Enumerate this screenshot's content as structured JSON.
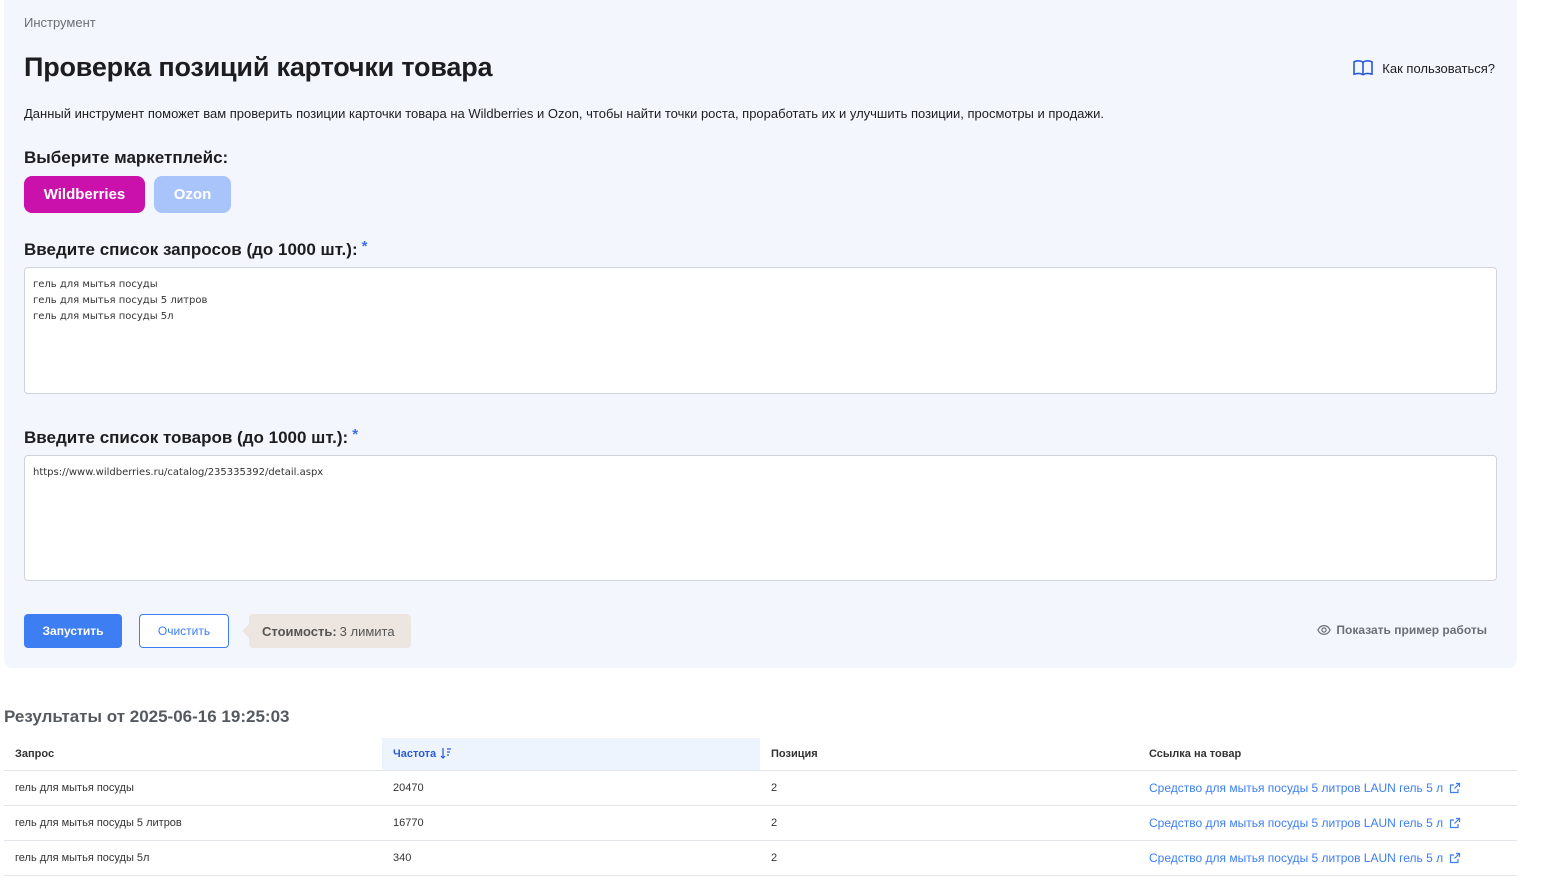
{
  "breadcrumb": "Инструмент",
  "page_title": "Проверка позиций карточки товара",
  "help_link": "Как пользоваться?",
  "description": "Данный инструмент поможет вам проверить позиции карточки товара на Wildberries и Ozon, чтобы найти точки роста, проработать их и улучшить позиции, просмотры и продажи.",
  "marketplace": {
    "label": "Выберите маркетплейс:",
    "options": [
      "Wildberries",
      "Ozon"
    ],
    "selected": "Wildberries"
  },
  "queries": {
    "label": "Введите список запросов (до 1000 шт.):",
    "required_mark": "*",
    "value": "гель для мытья посуды\nгель для мытья посуды 5 литров\nгель для мытья посуды 5л"
  },
  "products": {
    "label": "Введите список товаров (до 1000 шт.):",
    "required_mark": "*",
    "value": "https://www.wildberries.ru/catalog/235335392/detail.aspx"
  },
  "actions": {
    "run": "Запустить",
    "clear": "Очистить",
    "cost_label": "Стоимость:",
    "cost_value": "3 лимита",
    "example": "Показать пример работы"
  },
  "results": {
    "title": "Результаты от 2025-06-16 19:25:03",
    "columns": [
      "Запрос",
      "Частота",
      "Позиция",
      "Ссылка на товар"
    ],
    "rows": [
      {
        "query": "гель для мытья посуды",
        "frequency": "20470",
        "position": "2",
        "link": "Средство для мытья посуды 5 литров LAUN гель 5 л"
      },
      {
        "query": "гель для мытья посуды 5 литров",
        "frequency": "16770",
        "position": "2",
        "link": "Средство для мытья посуды 5 литров LAUN гель 5 л"
      },
      {
        "query": "гель для мытья посуды 5л",
        "frequency": "340",
        "position": "2",
        "link": "Средство для мытья посуды 5 литров LAUN гель 5 л"
      }
    ]
  },
  "icons": {
    "help": "book-icon",
    "example": "eye-icon",
    "sort": "sort-desc-icon",
    "external": "external-link-icon"
  },
  "colors": {
    "wildberries": "#cb11ab",
    "ozon": "#a9c4fb",
    "primary": "#3d7ef2",
    "card_bg": "#f3f7fd"
  }
}
